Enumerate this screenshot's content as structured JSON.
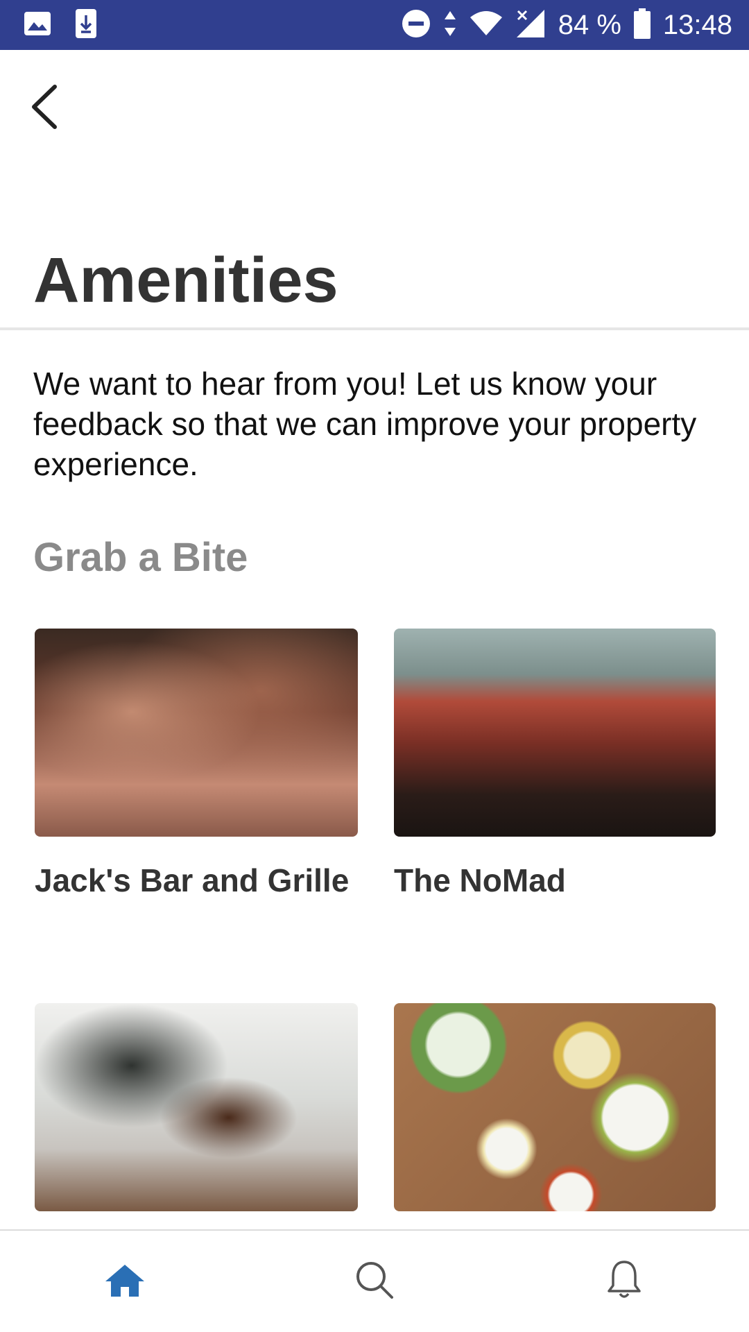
{
  "status_bar": {
    "battery": "84 %",
    "time": "13:48",
    "background": "#303f8f",
    "icons": [
      "gallery-icon",
      "download-icon",
      "do-not-disturb-icon",
      "data-arrows-icon",
      "wifi-icon",
      "signal-icon",
      "battery-icon"
    ]
  },
  "header": {
    "back_icon": "chevron-left-icon",
    "title": "Amenities"
  },
  "intro": {
    "text": "We want to hear from you! Let us know your feedback so that we can improve your property experience."
  },
  "section": {
    "title": "Grab a Bite",
    "cards": [
      {
        "label": "Jack's Bar and Grille",
        "image": "restaurant-bar-photo"
      },
      {
        "label": "The NoMad",
        "image": "restaurant-atrium-photo"
      },
      {
        "label": "",
        "image": "coffee-photo"
      },
      {
        "label": "",
        "image": "food-table-photo"
      }
    ]
  },
  "bottom_nav": {
    "items": [
      {
        "icon": "home-icon",
        "active": true
      },
      {
        "icon": "search-icon",
        "active": false
      },
      {
        "icon": "bell-icon",
        "active": false
      }
    ],
    "active_color": "#2a6fb5",
    "inactive_color": "#555555"
  }
}
